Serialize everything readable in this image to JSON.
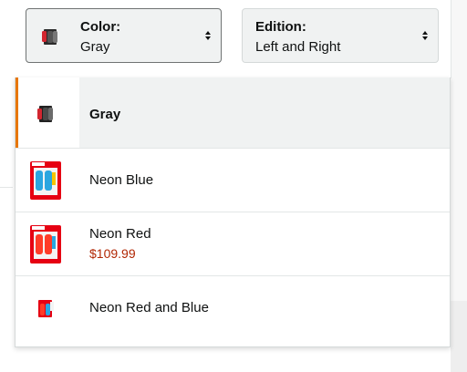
{
  "selectors": {
    "color": {
      "label": "Color:",
      "value": "Gray",
      "thumb_icon": "joycon-gray-product-icon",
      "arrow_icon": "updown-caret-icon"
    },
    "edition": {
      "label": "Edition:",
      "value": "Left and Right",
      "arrow_icon": "updown-caret-icon"
    }
  },
  "dropdown": {
    "options": [
      {
        "name": "Gray",
        "price": "",
        "selected": true,
        "icon": "joycon-gray-product-icon"
      },
      {
        "name": "Neon Blue",
        "price": "",
        "selected": false,
        "icon": "joycon-neon-blue-box-icon"
      },
      {
        "name": "Neon Red",
        "price": "$109.99",
        "selected": false,
        "icon": "joycon-neon-red-box-icon"
      },
      {
        "name": "Neon Red and Blue",
        "price": "",
        "selected": false,
        "icon": "joycon-neon-red-blue-product-icon"
      }
    ]
  },
  "colors": {
    "selected_accent": "#e77600",
    "price": "#b12704",
    "selected_bg": "#f0f2f2",
    "text": "#0f1111"
  }
}
